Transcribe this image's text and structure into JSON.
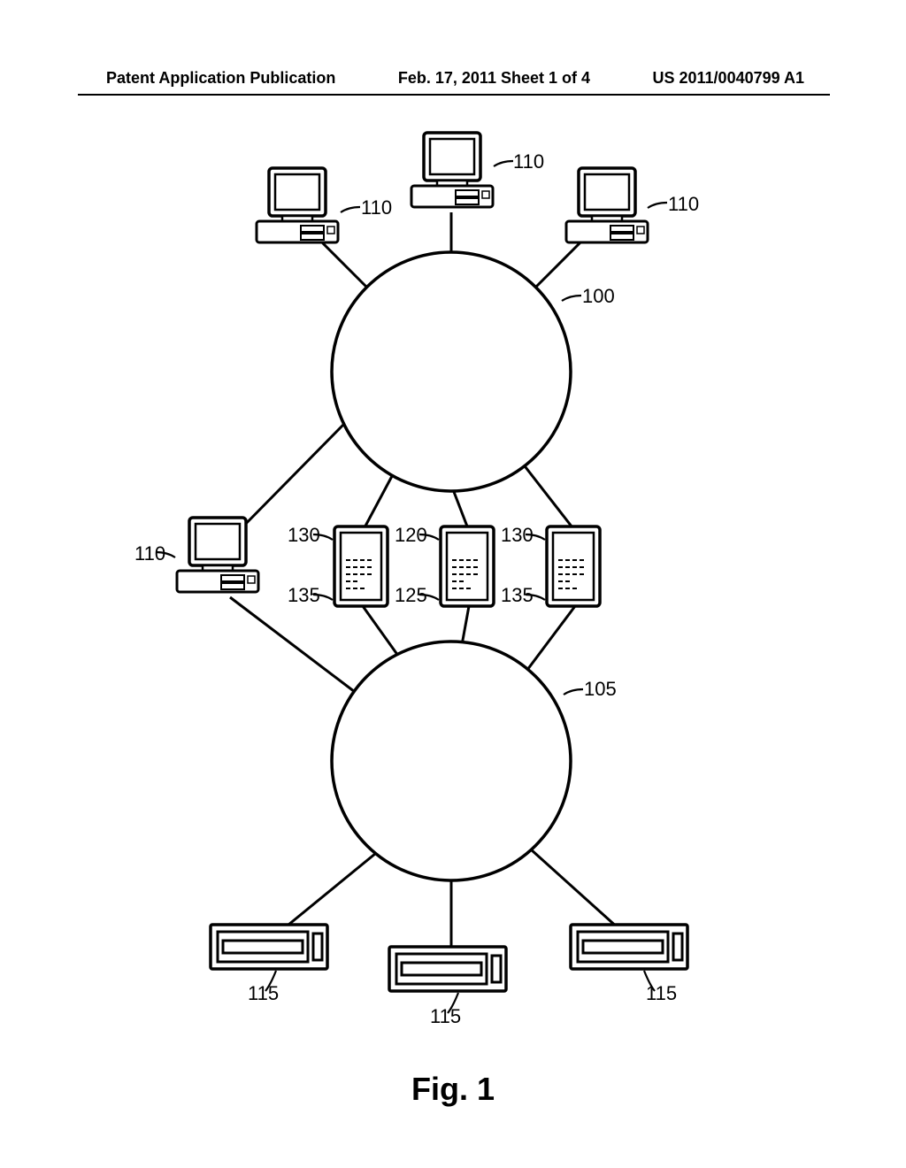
{
  "header": {
    "left": "Patent Application Publication",
    "center": "Feb. 17, 2011  Sheet 1 of 4",
    "right": "US 2011/0040799 A1"
  },
  "figure_title": "Fig. 1",
  "labels": {
    "net_upper": "100",
    "net_lower": "105",
    "client_top_left": "110",
    "client_top_mid": "110",
    "client_top_right": "110",
    "client_mid_left": "110",
    "server_mid_left_top": "130",
    "server_mid_left_bot": "135",
    "server_mid_center_top": "120",
    "server_mid_center_bot": "125",
    "server_mid_right_top": "130",
    "server_mid_right_bot": "135",
    "storage_left": "115",
    "storage_mid": "115",
    "storage_right": "115"
  }
}
